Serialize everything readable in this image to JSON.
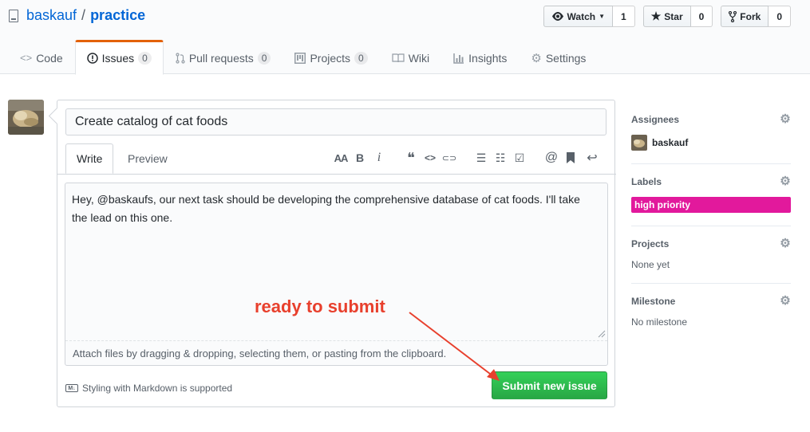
{
  "repo": {
    "owner": "baskauf",
    "separator": "/",
    "name": "practice"
  },
  "actions": {
    "watch": {
      "label": "Watch",
      "count": "1"
    },
    "star": {
      "label": "Star",
      "count": "0"
    },
    "fork": {
      "label": "Fork",
      "count": "0"
    }
  },
  "nav": [
    {
      "label": "Code",
      "icon": "code-icon"
    },
    {
      "label": "Issues",
      "count": "0",
      "icon": "issue-icon",
      "selected": true
    },
    {
      "label": "Pull requests",
      "count": "0",
      "icon": "pull-request-icon"
    },
    {
      "label": "Projects",
      "count": "0",
      "icon": "project-icon"
    },
    {
      "label": "Wiki",
      "icon": "book-icon"
    },
    {
      "label": "Insights",
      "icon": "graph-icon"
    },
    {
      "label": "Settings",
      "icon": "gear-icon"
    }
  ],
  "composer": {
    "title_value": "Create catalog of cat foods",
    "tabs": {
      "write": "Write",
      "preview": "Preview"
    },
    "toolbar": {
      "heading": "AA",
      "bold": "B",
      "italic": "i",
      "quote": "❝",
      "code": "<>",
      "link": "⊂⊃",
      "ul": "☰",
      "ol": "☷",
      "task": "☑",
      "mention": "@",
      "reference": "🔖",
      "reply": "↩"
    },
    "body": "Hey, @baskaufs, our next task should be developing the comprehensive database of cat foods.  I'll take the lead on this one.",
    "drag_hint": "Attach files by dragging & dropping, selecting them, or pasting from the clipboard.",
    "markdown_hint": "Styling with Markdown is supported",
    "markdown_badge": "M↓",
    "submit_label": "Submit new issue"
  },
  "annotation": {
    "text": "ready to submit",
    "color": "#e8402d"
  },
  "sidebar": {
    "assignees": {
      "heading": "Assignees",
      "user": "baskauf"
    },
    "labels": {
      "heading": "Labels",
      "label": "high priority",
      "color": "#e2199c"
    },
    "projects": {
      "heading": "Projects",
      "value": "None yet"
    },
    "milestone": {
      "heading": "Milestone",
      "value": "No milestone"
    }
  },
  "colors": {
    "link": "#0366d6",
    "submit": "#28a745",
    "issues_tab_accent": "#e36209"
  }
}
